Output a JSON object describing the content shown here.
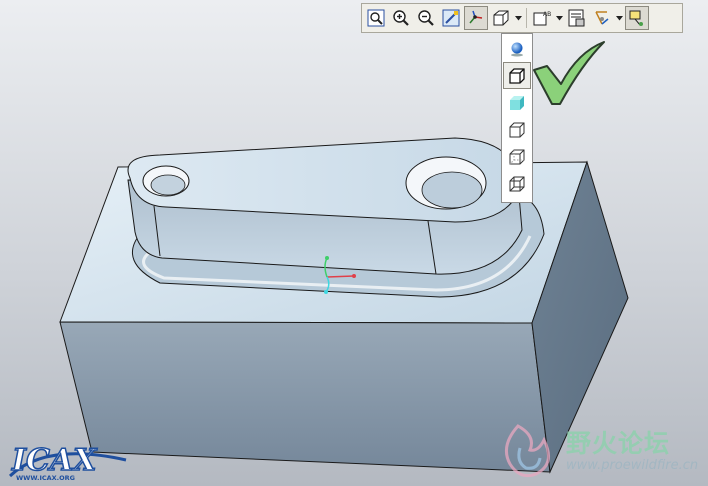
{
  "toolbar": {
    "buttons": [
      {
        "icon": "refit-icon"
      },
      {
        "icon": "zoom-in-icon"
      },
      {
        "icon": "zoom-out-icon"
      },
      {
        "icon": "repaint-icon"
      },
      {
        "icon": "spin-center-icon",
        "active": true
      },
      {
        "icon": "display-style-icon",
        "has_dropdown": true
      },
      {
        "icon": "saved-views-icon",
        "has_dropdown": true
      },
      {
        "icon": "view-manager-icon"
      },
      {
        "icon": "datum-display-icon",
        "has_dropdown": true
      },
      {
        "icon": "annotation-display-icon",
        "active": true
      }
    ]
  },
  "display_style_menu": {
    "items": [
      {
        "icon": "enhanced-realism-icon"
      },
      {
        "icon": "shading-with-edges-icon",
        "selected": true
      },
      {
        "icon": "shading-icon"
      },
      {
        "icon": "no-hidden-icon"
      },
      {
        "icon": "hidden-line-icon"
      },
      {
        "icon": "wireframe-icon"
      }
    ]
  },
  "overlay": {
    "icon": "checkmark-icon",
    "color": "#8bd17a"
  },
  "model": {
    "face_color": "#c8dbe8",
    "side_color": "#7b8c9c",
    "edge_color": "#1a1a1a"
  },
  "watermark_left": {
    "text": "WWW.ICAX.ORG"
  },
  "watermark_right": {
    "text_cn": "野火论坛",
    "url": "www.proewildfire.cn"
  }
}
